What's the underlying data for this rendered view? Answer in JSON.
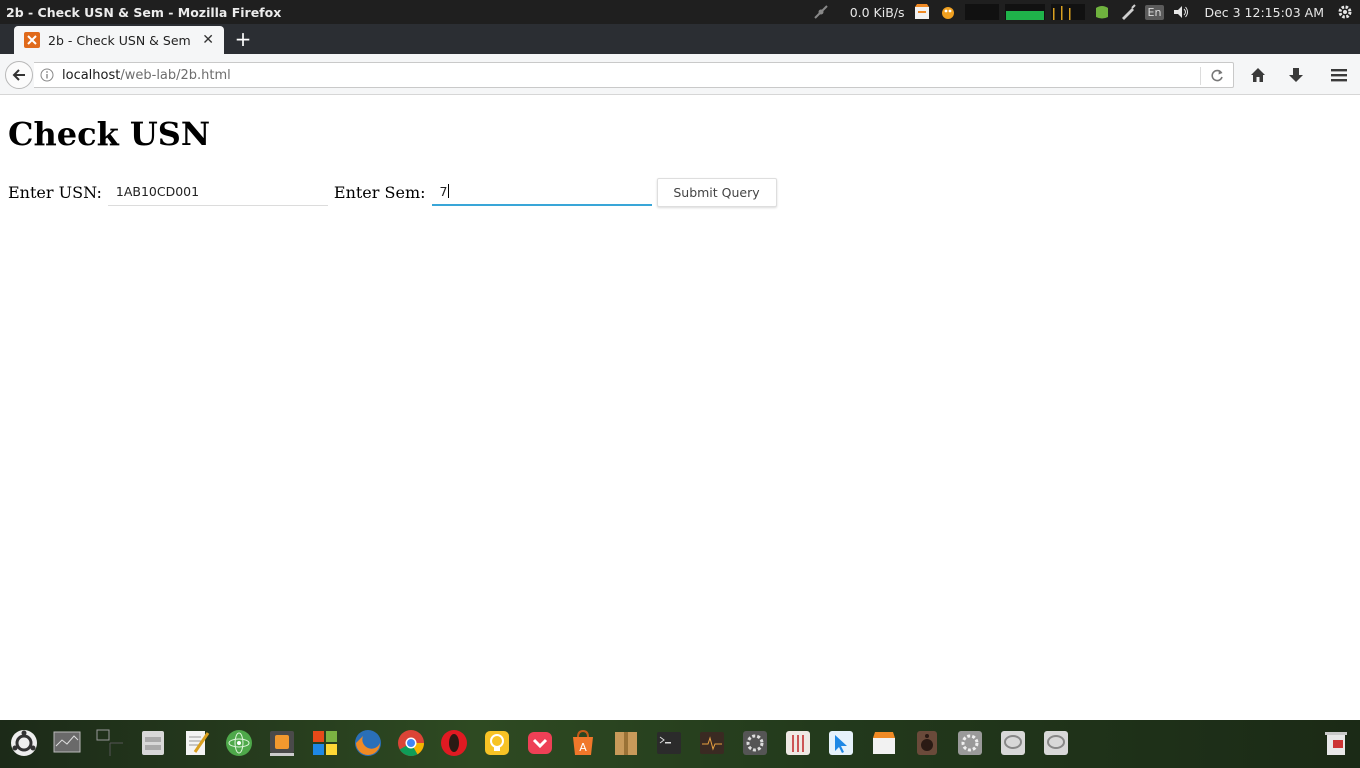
{
  "window": {
    "title": "2b - Check USN & Sem - Mozilla Firefox"
  },
  "system_tray": {
    "net_speed": "0.0 KiB/s",
    "language": "En",
    "clock": "Dec  3 12:15:03 AM"
  },
  "tabs": [
    {
      "label": "2b - Check USN & Sem",
      "close_glyph": "✕"
    }
  ],
  "new_tab_glyph": "+",
  "url": {
    "host": "localhost",
    "path": "/web-lab/2b.html"
  },
  "page": {
    "heading": "Check USN",
    "usn_label": "Enter USN:",
    "usn_value": "1AB10CD001",
    "sem_label": "Enter Sem:",
    "sem_value": "7",
    "submit_label": "Submit Query"
  },
  "dock_icons": [
    "ubuntu-logo-icon",
    "system-monitor-icon",
    "workspace-switcher-icon",
    "file-manager-icon",
    "text-editor-icon",
    "atom-editor-icon",
    "sublime-text-icon",
    "windows-logo-icon",
    "firefox-icon",
    "chrome-icon",
    "opera-icon",
    "idea-bulb-icon",
    "pocket-icon",
    "software-center-icon",
    "archive-manager-icon",
    "terminal-icon",
    "activity-monitor-icon",
    "settings-tweak-icon",
    "mixer-icon",
    "cursor-icon",
    "clapper-icon",
    "speaker-icon",
    "system-settings-icon",
    "chat-icon",
    "chat-alt-icon",
    "trash-icon"
  ],
  "colors": {
    "focus_accent": "#39a6d8",
    "tab_favicon": "#e06a1b",
    "opera_red": "#e01a22"
  }
}
